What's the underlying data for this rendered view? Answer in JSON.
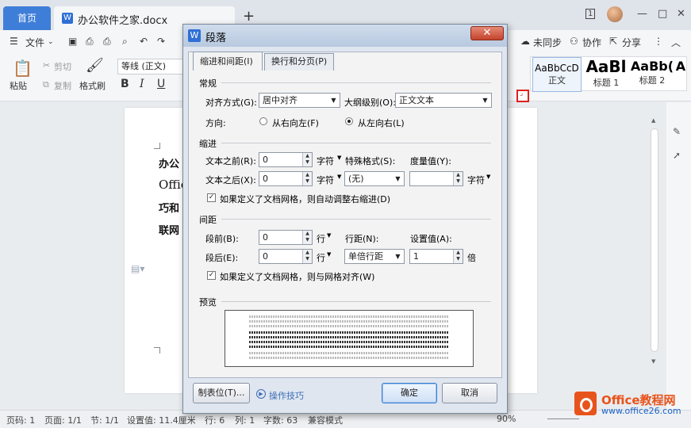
{
  "app": {
    "home_tab": "首页",
    "doc_tab": "办公软件之家.docx",
    "badge": "1"
  },
  "menu": {
    "file": "文件",
    "unsync": "未同步",
    "collab": "协作",
    "share": "分享"
  },
  "ribbon": {
    "paste": "粘贴",
    "cut": "剪切",
    "copy": "复制",
    "format_painter": "格式刷",
    "font_name": "等线 (正文)",
    "styles": [
      {
        "sample": "AaBbCcD",
        "label": "正文"
      },
      {
        "sample": "AaBl",
        "label": "标题 1"
      },
      {
        "sample": "AaBb(",
        "label": "标题 2"
      },
      {
        "sample": "A",
        "label": ""
      }
    ]
  },
  "document": {
    "lines": [
      "办公",
      "Offic",
      "巧和",
      "联网"
    ]
  },
  "dialog": {
    "title": "段落",
    "tabs": [
      "缩进和间距(I)",
      "换行和分页(P)"
    ],
    "general": {
      "section": "常规",
      "alignment_label": "对齐方式(G):",
      "alignment_value": "居中对齐",
      "outline_label": "大纲级别(O):",
      "outline_value": "正文文本",
      "direction_label": "方向:",
      "rtl_label": "从右向左(F)",
      "ltr_label": "从左向右(L)",
      "direction_selected": "ltr"
    },
    "indent": {
      "section": "缩进",
      "before_label": "文本之前(R):",
      "before_value": "0",
      "after_label": "文本之后(X):",
      "after_value": "0",
      "unit": "字符",
      "special_label": "特殊格式(S):",
      "special_value": "(无)",
      "measure_label": "度量值(Y):",
      "measure_value": "",
      "grid_check": "如果定义了文档网格，则自动调整右缩进(D)",
      "grid_checked": true
    },
    "spacing": {
      "section": "间距",
      "before_label": "段前(B):",
      "before_value": "0",
      "after_label": "段后(E):",
      "after_value": "0",
      "unit": "行",
      "line_label": "行距(N):",
      "line_value": "单倍行距",
      "setting_label": "设置值(A):",
      "setting_value": "1",
      "setting_unit": "倍",
      "grid_check": "如果定义了文档网格，则与网格对齐(W)",
      "grid_checked": true
    },
    "preview": {
      "section": "预览"
    },
    "buttons": {
      "tabs_btn": "制表位(T)...",
      "tips": "操作技巧",
      "ok": "确定",
      "cancel": "取消"
    }
  },
  "status": {
    "page_code": "页码: 1",
    "page": "页面: 1/1",
    "section": "节: 1/1",
    "setting": "设置值: 11.4厘米",
    "row": "行: 6",
    "col": "列: 1",
    "words": "字数: 63",
    "compat": "兼容模式",
    "zoom": "90%"
  },
  "watermark": {
    "title": "Office教程网",
    "url": "www.office26.com"
  }
}
